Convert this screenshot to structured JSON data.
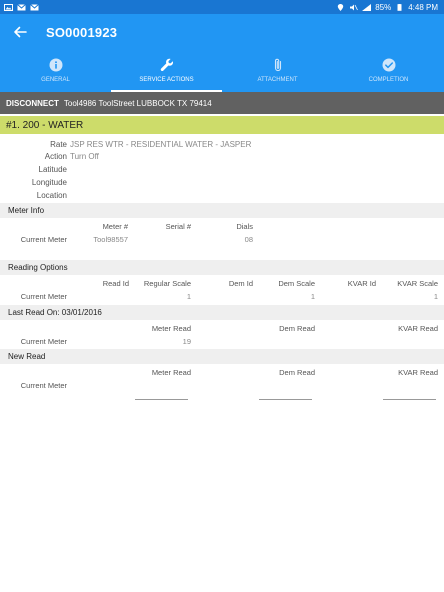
{
  "status": {
    "battery": "85%",
    "time": "4:48 PM"
  },
  "appbar": {
    "title": "SO0001923"
  },
  "tabs": [
    {
      "label": "GENERAL",
      "icon": "info-icon"
    },
    {
      "label": "SERVICE ACTIONS",
      "icon": "wrench-icon"
    },
    {
      "label": "ATTACHMENT",
      "icon": "paperclip-icon"
    },
    {
      "label": "COMPLETION",
      "icon": "check-circle-icon"
    }
  ],
  "disconnect": {
    "label": "DISCONNECT",
    "address": "Tool4986 ToolStreet LUBBOCK TX 79414"
  },
  "service": {
    "header": "#1. 200 - WATER",
    "rate_label": "Rate",
    "rate_value": "JSP RES WTR - RESIDENTIAL WATER - JASPER",
    "action_label": "Action",
    "action_value": "Turn Off",
    "latitude_label": "Latitude",
    "longitude_label": "Longitude",
    "location_label": "Location"
  },
  "meter_info": {
    "title": "Meter Info",
    "col_meter": "Meter #",
    "col_serial": "Serial #",
    "col_dials": "Dials",
    "row_label": "Current Meter",
    "meter": "Tool98557",
    "dials": "08"
  },
  "reading_options": {
    "title": "Reading Options",
    "col_read_id": "Read Id",
    "col_regular_scale": "Regular Scale",
    "col_dem_id": "Dem Id",
    "col_dem_scale": "Dem Scale",
    "col_kvar_id": "KVAR Id",
    "col_kvar_scale": "KVAR Scale",
    "row_label": "Current Meter",
    "regular_scale": "1",
    "dem_scale": "1",
    "kvar_scale": "1"
  },
  "last_read": {
    "title": "Last Read On: 03/01/2016",
    "col_meter_read": "Meter Read",
    "col_dem_read": "Dem Read",
    "col_kvar_read": "KVAR Read",
    "row_label": "Current Meter",
    "meter_read": "19"
  },
  "new_read": {
    "title": "New Read",
    "col_meter_read": "Meter Read",
    "col_dem_read": "Dem Read",
    "col_kvar_read": "KVAR Read",
    "row_label": "Current Meter"
  }
}
